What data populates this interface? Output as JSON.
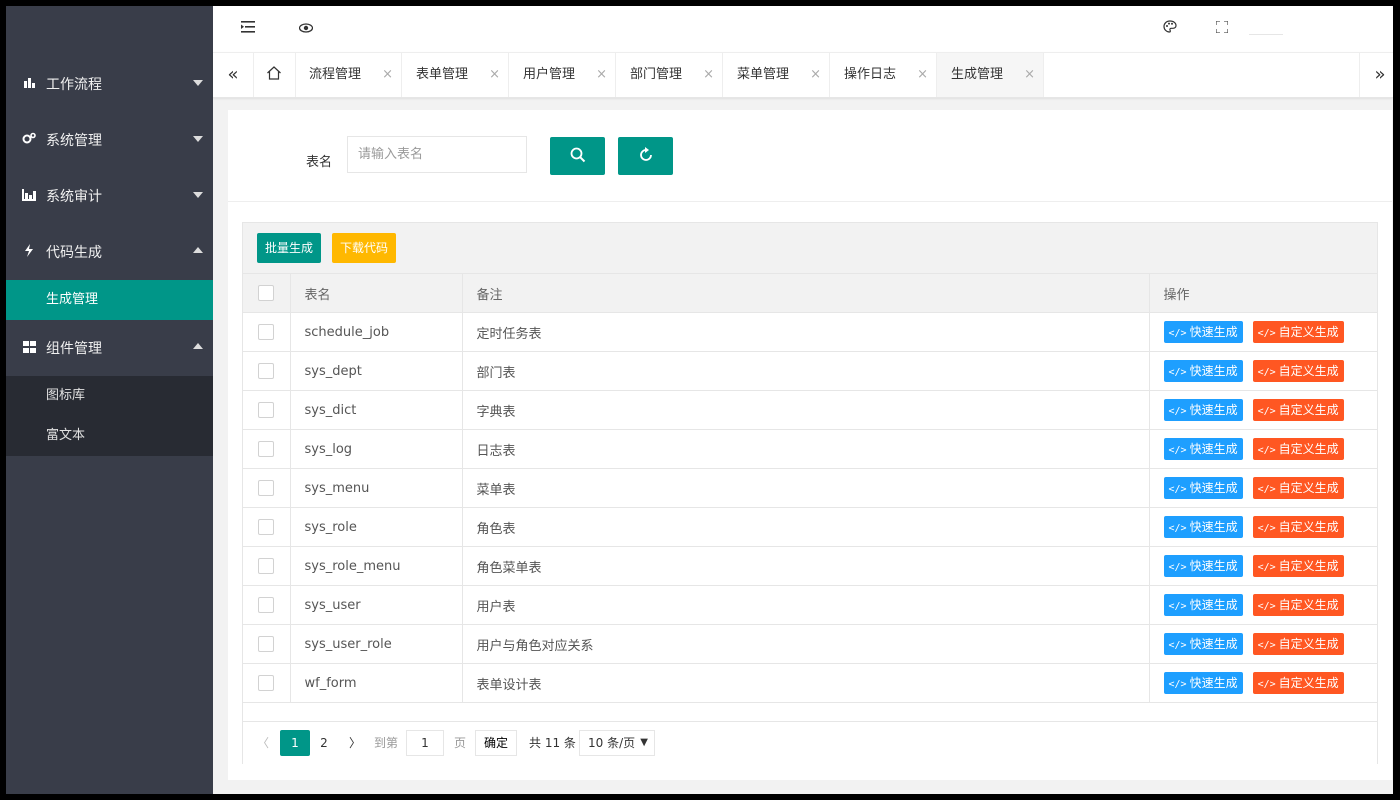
{
  "sidebar": {
    "items": [
      {
        "label": "工作流程",
        "icon": "workflow-icon",
        "expanded": false
      },
      {
        "label": "系统管理",
        "icon": "gears-icon",
        "expanded": false
      },
      {
        "label": "系统审计",
        "icon": "chart-icon",
        "expanded": false
      },
      {
        "label": "代码生成",
        "icon": "bolt-icon",
        "expanded": true,
        "children": [
          {
            "label": "生成管理",
            "active": true
          }
        ]
      },
      {
        "label": "组件管理",
        "icon": "grid-icon",
        "expanded": true,
        "children": [
          {
            "label": "图标库"
          },
          {
            "label": "富文本"
          }
        ]
      }
    ]
  },
  "header": {
    "left_icons": [
      "menu-collapse-icon",
      "eye-icon"
    ],
    "right_icons": [
      "palette-icon",
      "fullscreen-icon"
    ]
  },
  "tabs": {
    "items": [
      "流程管理",
      "表单管理",
      "用户管理",
      "部门管理",
      "菜单管理",
      "操作日志",
      "生成管理"
    ],
    "active": "生成管理",
    "close": "×"
  },
  "search": {
    "label": "表名",
    "placeholder": "请输入表名"
  },
  "toolbar": {
    "batch_label": "批量生成",
    "download_label": "下载代码"
  },
  "colors": {
    "primary": "#009688",
    "warn": "#ffb800",
    "blue": "#1e9fff",
    "red": "#ff5722",
    "sidebar": "#393d49"
  },
  "table": {
    "columns": [
      "表名",
      "备注",
      "操作"
    ],
    "rows": [
      {
        "name": "schedule_job",
        "comment": "定时任务表"
      },
      {
        "name": "sys_dept",
        "comment": "部门表"
      },
      {
        "name": "sys_dict",
        "comment": "字典表"
      },
      {
        "name": "sys_log",
        "comment": "日志表"
      },
      {
        "name": "sys_menu",
        "comment": "菜单表"
      },
      {
        "name": "sys_role",
        "comment": "角色表"
      },
      {
        "name": "sys_role_menu",
        "comment": "角色菜单表"
      },
      {
        "name": "sys_user",
        "comment": "用户表"
      },
      {
        "name": "sys_user_role",
        "comment": "用户与角色对应关系"
      },
      {
        "name": "wf_form",
        "comment": "表单设计表"
      }
    ],
    "actions": {
      "quick": "快速生成",
      "custom": "自定义生成",
      "code_glyph": "</>"
    }
  },
  "pagination": {
    "pages": [
      "1",
      "2"
    ],
    "current": "1",
    "goto_prefix": "到第",
    "goto_value": "1",
    "goto_suffix": "页",
    "confirm": "确定",
    "total": "共 11 条",
    "page_size": "10 条/页"
  }
}
